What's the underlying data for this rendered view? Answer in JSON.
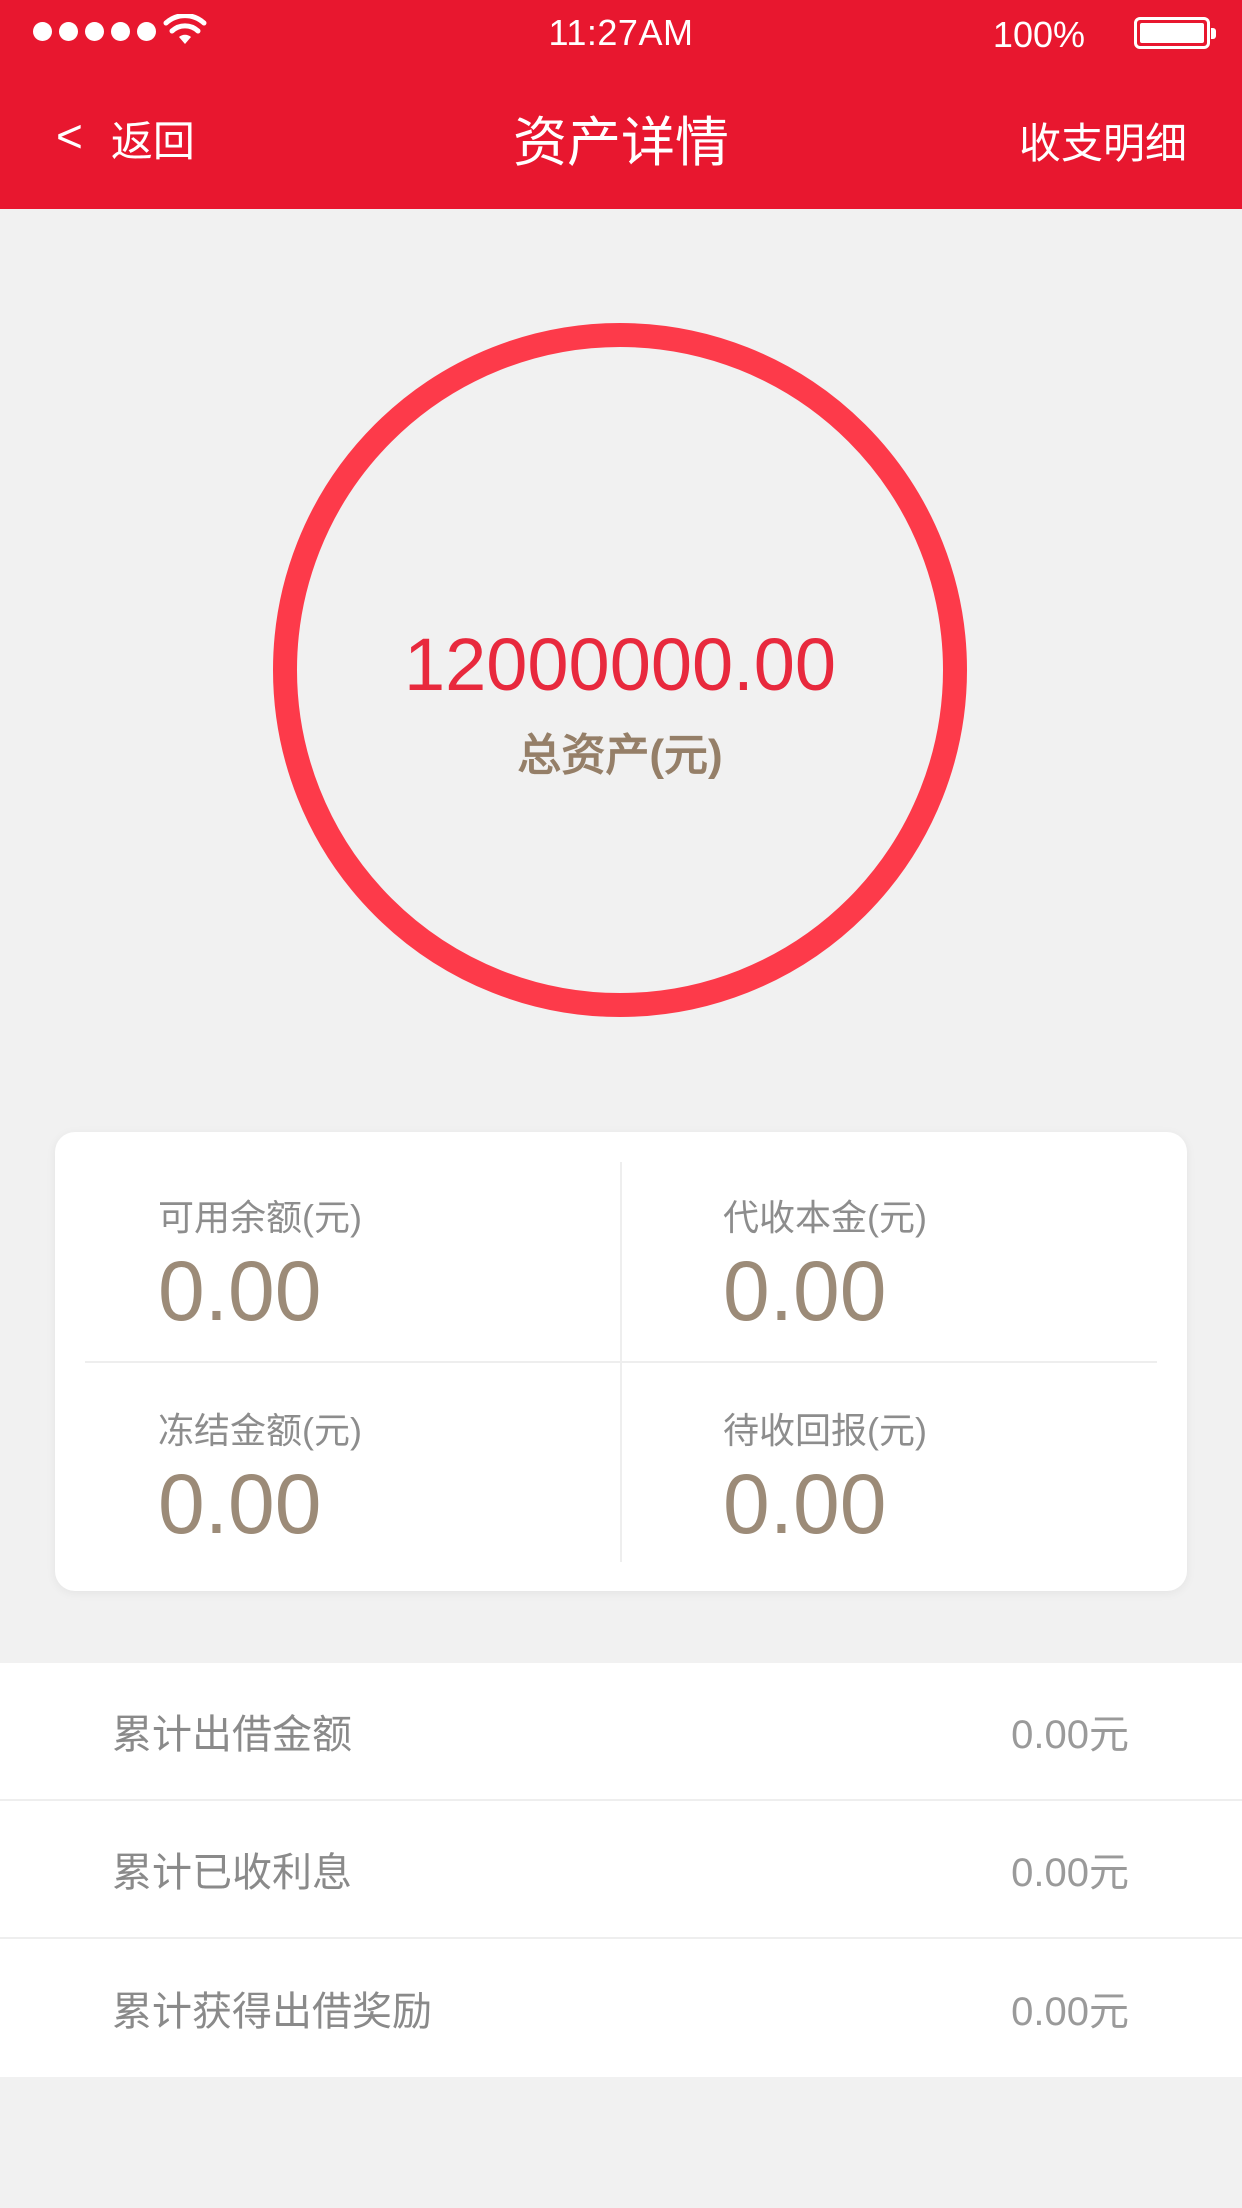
{
  "status_bar": {
    "time": "11:27AM",
    "battery_percent": "100%"
  },
  "nav": {
    "back_icon": "<",
    "back_label": "返回",
    "title": "资产详情",
    "right_label": "收支明细"
  },
  "summary": {
    "total_amount": "12000000.00",
    "total_label": "总资产(元)"
  },
  "grid": [
    {
      "label": "可用余额(元)",
      "value": "0.00"
    },
    {
      "label": "代收本金(元)",
      "value": "0.00"
    },
    {
      "label": "冻结金额(元)",
      "value": "0.00"
    },
    {
      "label": "待收回报(元)",
      "value": "0.00"
    }
  ],
  "stats": [
    {
      "label": "累计出借金额",
      "value": "0.00元"
    },
    {
      "label": "累计已收利息",
      "value": "0.00元"
    },
    {
      "label": "累计获得出借奖励",
      "value": "0.00元"
    }
  ],
  "colors": {
    "header": "#e8172f",
    "ring": "#fd3a4a",
    "amount": "#e8293d",
    "value": "#9c8b78"
  }
}
